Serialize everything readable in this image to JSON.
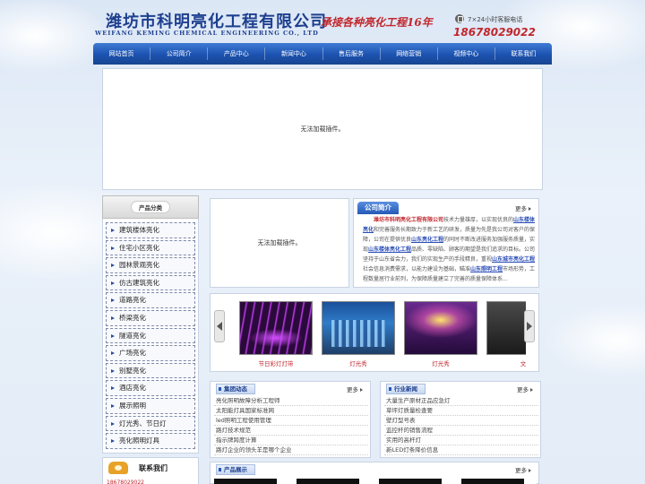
{
  "header": {
    "company_cn": "潍坊市科明亮化工程有限公司",
    "company_en": "WEIFANG KEMING CHEMICAL ENGINEERING CO., LTD",
    "slogan": "承接各种亮化工程16年",
    "phone_label": "7×24小时客服电话",
    "phone_number": "18678029022"
  },
  "nav": {
    "items": [
      "网站首页",
      "公司简介",
      "产品中心",
      "新闻中心",
      "售后服务",
      "网络营销",
      "视频中心",
      "联系我们"
    ]
  },
  "banner": {
    "plugin_text": "无法加载插件。"
  },
  "sidebar": {
    "title": "产品分类",
    "items": [
      "建筑楼体亮化",
      "住宅小区亮化",
      "园林景观亮化",
      "仿古建筑亮化",
      "道路亮化",
      "桥梁亮化",
      "隧道亮化",
      "广场亮化",
      "别墅亮化",
      "酒店亮化",
      "展示照明",
      "灯光秀、节日灯",
      "亮化照明灯具"
    ],
    "contact_title": "联系我们",
    "contact_line": "18678029022"
  },
  "flash": {
    "plugin_text": "无法加载插件。"
  },
  "about": {
    "tab": "公司简介",
    "more": "更多",
    "lead": "潍坊市科明亮化工程有限公司",
    "t1": "技术力量雄厚，以实现优良的",
    "l1": "山东楼体亮化",
    "t2": "和完善服务长期致力于新工艺的研发，质量为先是我公司对客户的保障，公司在提供优良",
    "l2": "山东亮化工程",
    "t3": "的同时不断改进服务加强服务质量，实现",
    "l3": "山东楼体亮化工程",
    "t4": "品质、零缺陷、顾客的期望是我们追求的目标。公司坚持于山东省会力，我们的实现生产的手段精良，重视",
    "l4": "山东城市亮化工程",
    "t5": "社会信息消费需求，以能力建设为基础，瞄准",
    "l5": "山东照明工程",
    "t6": "市场形势，工程数量居行业前列，为保障质量建立了完善的质量保障体系..."
  },
  "scroller": {
    "items": [
      {
        "caption": "节日彩灯灯带",
        "image": "led-strip-purple"
      },
      {
        "caption": "灯光秀",
        "image": "city-light-show"
      },
      {
        "caption": "灯光秀",
        "image": "stage-light-show"
      },
      {
        "caption": "文",
        "image": "dark-scene"
      }
    ]
  },
  "news_left": {
    "tab": "集团动态",
    "more": "更多",
    "items": [
      "亮化照明故障分析工程师",
      "太阳能灯具国家标准网",
      "led照明工程使用管理",
      "路灯技术规范",
      "指示牌跨度计算",
      "路灯企业的领头羊是哪个企业"
    ]
  },
  "news_right": {
    "tab": "行业新闻",
    "more": "更多",
    "items": [
      "大量生产原材正品应急灯",
      "草坪灯质量检查要",
      "壁灯型号表",
      "监控杆的销售流程",
      "实用的高杆灯",
      "新LED灯条降价信息"
    ]
  },
  "products": {
    "tab": "产品展示",
    "more": "更多"
  }
}
